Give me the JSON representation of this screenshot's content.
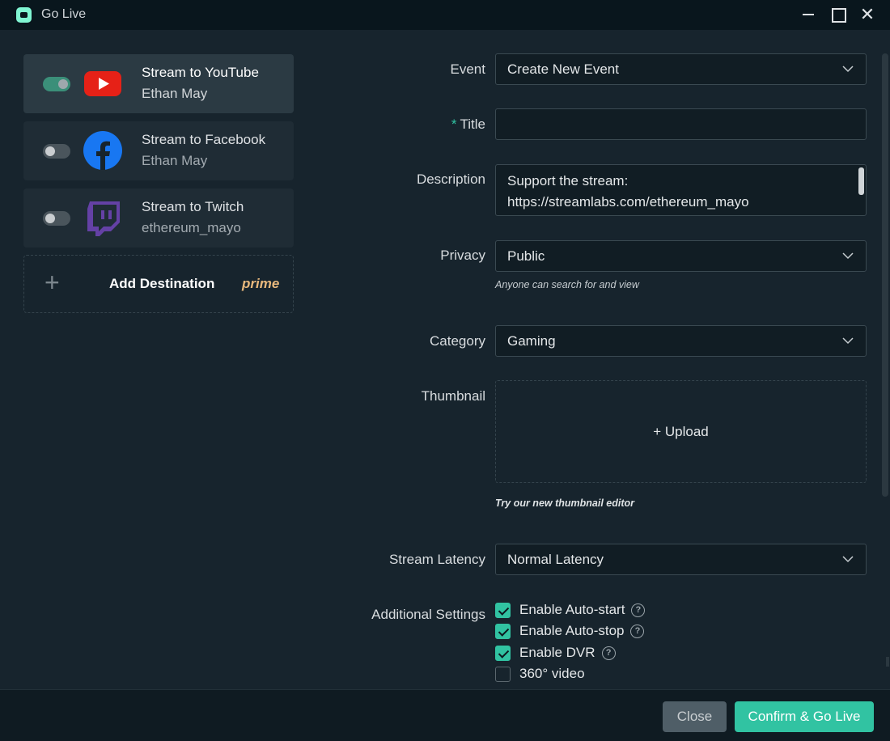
{
  "window": {
    "title": "Go Live"
  },
  "destinations": [
    {
      "title": "Stream to YouTube",
      "account": "Ethan May",
      "enabled": true,
      "icon": "youtube-icon"
    },
    {
      "title": "Stream to Facebook",
      "account": "Ethan May",
      "enabled": false,
      "icon": "facebook-icon"
    },
    {
      "title": "Stream to Twitch",
      "account": "ethereum_mayo",
      "enabled": false,
      "icon": "twitch-icon"
    }
  ],
  "add_destination": {
    "label": "Add Destination",
    "badge": "prime"
  },
  "form": {
    "event": {
      "label": "Event",
      "value": "Create New Event"
    },
    "title": {
      "required_mark": "*",
      "label": "Title",
      "value": ""
    },
    "description": {
      "label": "Description",
      "line1": "Support the stream:",
      "line2": "https://streamlabs.com/ethereum_mayo"
    },
    "privacy": {
      "label": "Privacy",
      "value": "Public",
      "hint": "Anyone can search for and view"
    },
    "category": {
      "label": "Category",
      "value": "Gaming"
    },
    "thumbnail": {
      "label": "Thumbnail",
      "upload": "+ Upload",
      "hint": "Try our new thumbnail editor"
    },
    "latency": {
      "label": "Stream Latency",
      "value": "Normal Latency"
    },
    "additional": {
      "label": "Additional Settings",
      "options": [
        {
          "label": "Enable Auto-start",
          "checked": true,
          "help": "?"
        },
        {
          "label": "Enable Auto-stop",
          "checked": true,
          "help": "?"
        },
        {
          "label": "Enable DVR",
          "checked": true,
          "help": "?"
        },
        {
          "label": "360° video",
          "checked": false
        }
      ]
    }
  },
  "footer": {
    "close": "Close",
    "confirm": "Confirm & Go Live"
  },
  "colors": {
    "accent": "#31c3a2",
    "youtube": "#e62117",
    "facebook": "#1877f2",
    "twitch": "#6441a5",
    "prime": "#e9b97d"
  }
}
